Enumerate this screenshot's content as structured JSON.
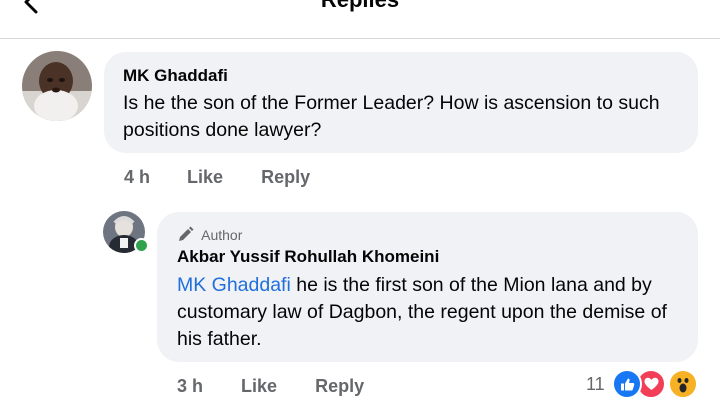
{
  "header": {
    "title": "Replies",
    "back_icon": "arrow-left-icon"
  },
  "comments": [
    {
      "author": "MK Ghaddafi",
      "text": "Is he the son of the Former Leader? How is ascension to such positions done lawyer?",
      "time": "4 h",
      "like_label": "Like",
      "reply_label": "Reply"
    },
    {
      "badge": "Author",
      "badge_icon": "pencil-icon",
      "author": "Akbar Yussif Rohullah Khomeini",
      "mention": "MK Ghaddafi",
      "text": " he is the first son of the Mion lana and by customary law of Dagbon, the regent upon the demise of his father.",
      "time": "3 h",
      "like_label": "Like",
      "reply_label": "Reply",
      "reaction_count": "11",
      "reaction_icons": [
        "like-reaction-icon",
        "love-reaction-icon",
        "wow-reaction-icon"
      ],
      "online": true
    }
  ],
  "colors": {
    "bubble": "#f0f2f5",
    "secondary_text": "#65676b",
    "mention": "#216fdb",
    "like_blue": "#1877f2",
    "love_red": "#f33e58",
    "wow_yellow": "#f7b125",
    "online_green": "#31a24c"
  }
}
